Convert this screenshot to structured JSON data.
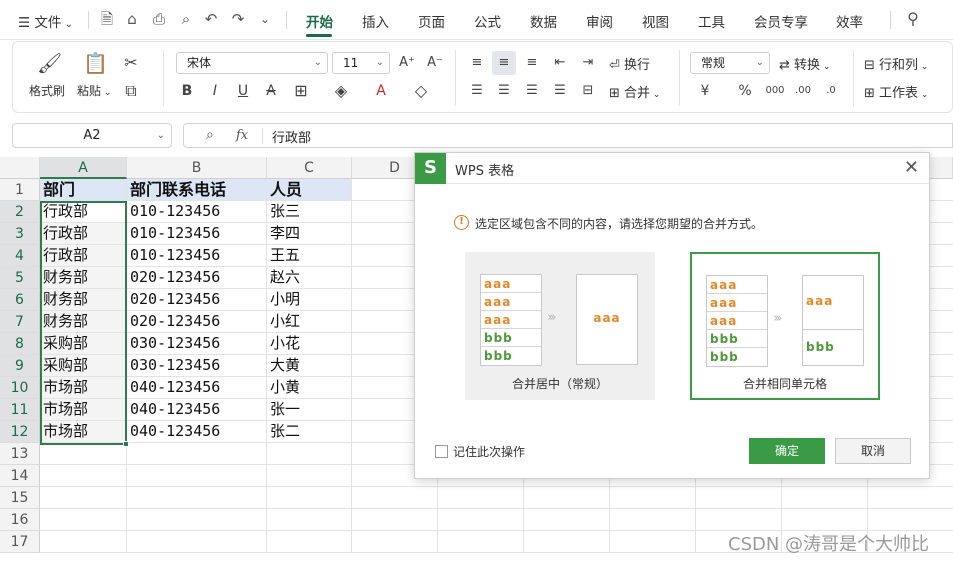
{
  "menubar": {
    "file": "文件",
    "tabs": [
      "开始",
      "插入",
      "页面",
      "公式",
      "数据",
      "审阅",
      "视图",
      "工具",
      "会员专享",
      "效率"
    ]
  },
  "ribbon": {
    "format_painter": "格式刷",
    "paste": "粘贴",
    "font_name": "宋体",
    "font_size": "11",
    "wrap": "换行",
    "merge": "合并",
    "number_format": "常规",
    "convert": "转换",
    "rows_cols": "行和列",
    "sheet": "工作表"
  },
  "formula": {
    "name_box": "A2",
    "fx": "fx",
    "content": "行政部"
  },
  "sheet": {
    "columns": [
      "A",
      "B",
      "C",
      "D"
    ],
    "rows": [
      "1",
      "2",
      "3",
      "4",
      "5",
      "6",
      "7",
      "8",
      "9",
      "10",
      "11",
      "12",
      "13",
      "14",
      "15",
      "16",
      "17"
    ],
    "header": [
      "部门",
      "部门联系电话",
      "人员"
    ],
    "data": [
      [
        "行政部",
        "010-123456",
        "张三"
      ],
      [
        "行政部",
        "010-123456",
        "李四"
      ],
      [
        "行政部",
        "010-123456",
        "王五"
      ],
      [
        "财务部",
        "020-123456",
        "赵六"
      ],
      [
        "财务部",
        "020-123456",
        "小明"
      ],
      [
        "财务部",
        "020-123456",
        "小红"
      ],
      [
        "采购部",
        "030-123456",
        "小花"
      ],
      [
        "采购部",
        "030-123456",
        "大黄"
      ],
      [
        "市场部",
        "040-123456",
        "小黄"
      ],
      [
        "市场部",
        "040-123456",
        "张一"
      ],
      [
        "市场部",
        "040-123456",
        "张二"
      ]
    ]
  },
  "dialog": {
    "title": "WPS 表格",
    "message": "选定区域包含不同的内容，请选择您期望的合并方式。",
    "option1_label": "合并居中（常规）",
    "option2_label": "合并相同单元格",
    "sample_a": "aaa",
    "sample_b": "bbb",
    "remember": "记住此次操作",
    "ok": "确定",
    "cancel": "取消"
  },
  "watermark": "CSDN @涛哥是个大帅比",
  "colors": {
    "accent": "#1b6b4a",
    "dialog_green": "#3a9a46",
    "header_fill": "#dce6f4",
    "sample_a": "#e18a2c",
    "sample_b": "#4e9a3b"
  }
}
